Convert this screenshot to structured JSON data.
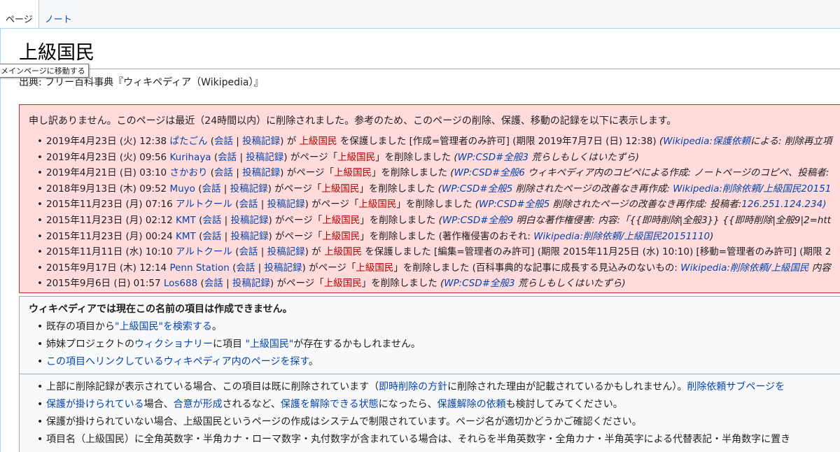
{
  "tabs": [
    {
      "label": "ページ",
      "selected": true
    },
    {
      "label": "ノート",
      "selected": false
    }
  ],
  "title": "上級国民",
  "site_sub": "出典: フリー百科事典『ウィキペディア（Wikipedia）』",
  "tooltip": "メインページに移動する",
  "log": {
    "intro": "申し訳ありません。このページは最近（24時間以内）に削除されました。参考のため、このページの削除、保護、移動の記録を以下に表示します。",
    "entries": [
      {
        "ts": "2019年4月23日 (火) 12:38",
        "user": "ぱたごん",
        "talk": "会話",
        "contribs": "投稿記録",
        "a1": "が",
        "target": "上級国民",
        "action": "を保護しました [作成=管理者のみ許可] (期限 2019年7月7日 (日) 12:38)",
        "cl": "Wikipedia:保護依頼",
        "tail": "による: 削除再立項"
      },
      {
        "ts": "2019年4月23日 (火) 09:56",
        "user": "Kurihaya",
        "talk": "会話",
        "contribs": "投稿記録",
        "a1": "がページ「",
        "target": "上級国民",
        "action": "」を削除しました",
        "cl": "WP:CSD#全般3",
        "tail": "荒らしもしくはいたずら)"
      },
      {
        "ts": "2019年4月21日 (日) 03:10",
        "user": "さかおり",
        "talk": "会話",
        "contribs": "投稿記録",
        "a1": "がページ「",
        "target": "上級国民",
        "action": "」を削除しました",
        "cl": "WP:CSD#全般6",
        "tail": "ウィキペディア内のコピペによる作成: ノートページのコピペ、投稿者:"
      },
      {
        "ts": "2018年9月13日 (木) 09:52",
        "user": "Muyo",
        "talk": "会話",
        "contribs": "投稿記録",
        "a1": "がページ「",
        "target": "上級国民",
        "action": "」を削除しました",
        "cl": "WP:CSD#全般5",
        "tail": "削除されたページの改善なき再作成:",
        "cl2": "Wikipedia:削除依頼/上級国民20151"
      },
      {
        "ts": "2015年11月23日 (月) 07:16",
        "user": "アルトクール",
        "talk": "会話",
        "contribs": "投稿記録",
        "a1": "がページ「",
        "target": "上級国民",
        "action": "」を削除しました",
        "cl": "WP:CSD#全般5",
        "tail": "削除されたページの改善なき再作成: 投稿者:",
        "cl2": "126.251.124.234)"
      },
      {
        "ts": "2015年11月23日 (月) 02:12",
        "user": "KMT",
        "talk": "会話",
        "contribs": "投稿記録",
        "a1": "がページ「",
        "target": "上級国民",
        "action": "」を削除しました",
        "cl": "WP:CSD#全般9",
        "tail": "明白な著作権侵害: 内容:「{{即時削除|全般3}} {{即時削除|全般9|2=htt"
      },
      {
        "ts": "2015年11月23日 (月) 00:24",
        "user": "KMT",
        "talk": "会話",
        "contribs": "投稿記録",
        "a1": "がページ「",
        "target": "上級国民",
        "action": "」を削除しました (著作権侵害のおそれ:",
        "cl": "Wikipedia:削除依頼/上級国民20151110",
        "tail": ")"
      },
      {
        "ts": "2015年11月11日 (水) 10:10",
        "user": "アルトクール",
        "talk": "会話",
        "contribs": "投稿記録",
        "a1": "が",
        "target": "上級国民",
        "action": "を保護しました [編集=管理者のみ許可] (期限 2015年11月25日 (水) 10:10) [移動=管理者のみ許可] (期限 2",
        "cl": "",
        "tail": ""
      },
      {
        "ts": "2015年9月17日 (木) 12:14",
        "user": "Penn Station",
        "talk": "会話",
        "contribs": "投稿記録",
        "a1": "がページ「",
        "target": "上級国民",
        "action": "」を削除しました (百科事典的な記事に成長する見込みのないもの:",
        "cl": "Wikipedia:削除依頼/上級国民",
        "tail": "内容"
      },
      {
        "ts": "2015年9月6日 (日) 01:57",
        "user": "Los688",
        "talk": "会話",
        "contribs": "投稿記録",
        "a1": "がページ「",
        "target": "上級国民",
        "action": "」を削除しました",
        "cl": "WP:CSD#全般3",
        "tail": "荒らしもしくはいたずら)"
      }
    ]
  },
  "notice": {
    "heading": "ウィキペディアでは現在この名前の項目は作成できません。",
    "items": [
      {
        "pre": "既存の項目から",
        "link": "\"上級国民\"を検索する",
        "post": "。"
      },
      {
        "pre": "姉妹プロジェクトの",
        "link": "ウィクショナリー",
        "post": "に項目 ",
        "link2": "\"上級国民\"",
        "post2": "が存在するかもしれません。"
      },
      {
        "pre": "",
        "link": "この項目へリンクしているウィキペディア内のページを探す",
        "post": "。"
      }
    ]
  },
  "notice2": {
    "items": [
      {
        "pre": "上部に削除記録が表示されている場合、この項目は既に削除されています（",
        "link": "即時削除の方針",
        "post": "に削除された理由が記載されているかもしれません）。",
        "link2": "削除依頼サブページを"
      },
      {
        "pre": "",
        "link": "保護が掛けられている",
        "post": "場合、",
        "link2": "合意が形成",
        "post2": "されるなど、",
        "link3": "保護を解除できる状態",
        "post3": "になったら、",
        "link4": "保護解除の依頼",
        "post4": "も検討してみてください。"
      },
      {
        "pre": "保護が掛けられていない場合、上級国民というページの作成はシステムで制限されています。ページ名が適切かどうかご確認ください。"
      },
      {
        "pre": "項目名（上級国民）に全角英数字・半角カナ・ローマ数字・丸付数字が含まれている場合は、それらを半角英数字・全角カナ・半角英字による代替表記・半角数字に置き"
      }
    ]
  }
}
